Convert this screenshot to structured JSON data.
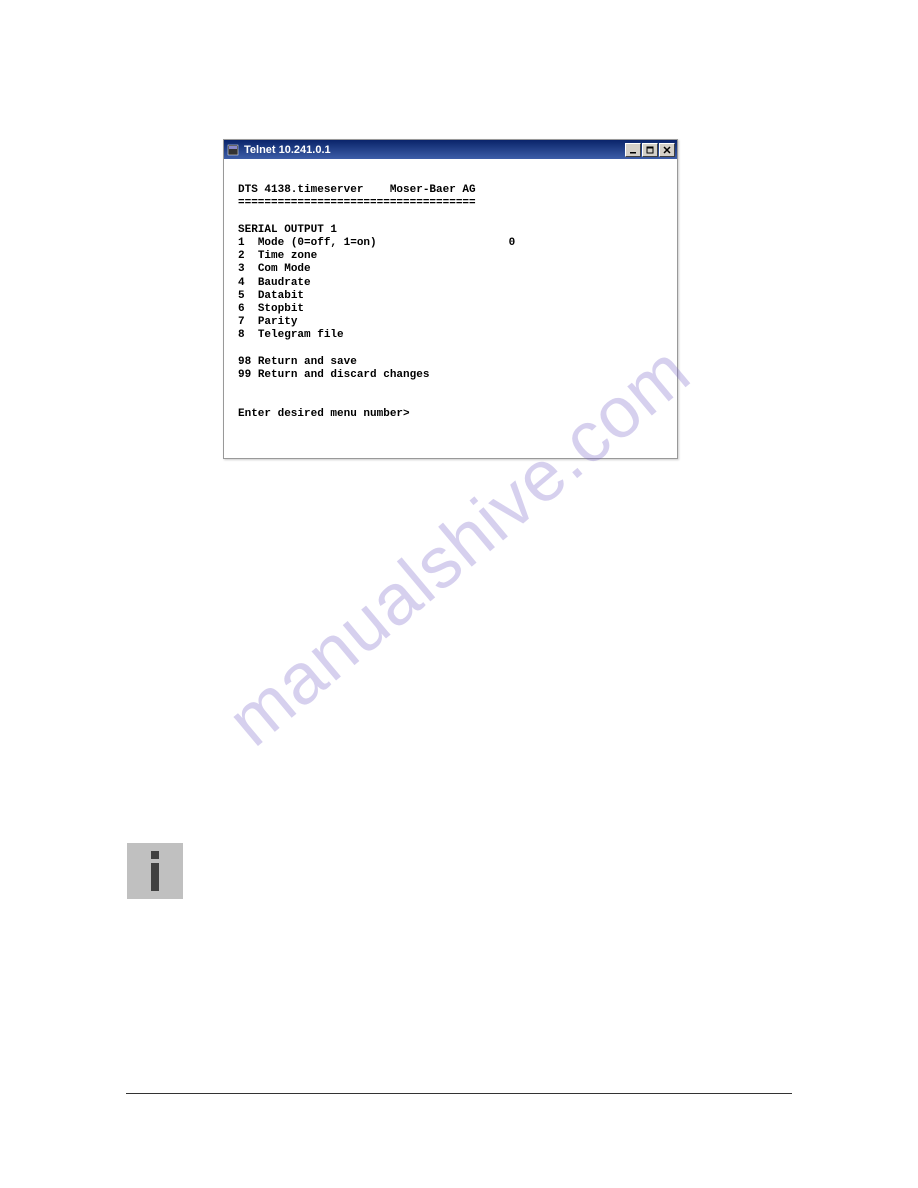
{
  "window": {
    "title": "Telnet 10.241.0.1"
  },
  "terminal": {
    "header_line1": "DTS 4138.timeserver    Moser-Baer AG",
    "header_line2": "====================================",
    "section_title": "SERIAL OUTPUT 1",
    "menu_items": [
      {
        "num": "1",
        "label": "Mode (0=off, 1=on)",
        "value": "0"
      },
      {
        "num": "2",
        "label": "Time zone",
        "value": ""
      },
      {
        "num": "3",
        "label": "Com Mode",
        "value": ""
      },
      {
        "num": "4",
        "label": "Baudrate",
        "value": ""
      },
      {
        "num": "5",
        "label": "Databit",
        "value": ""
      },
      {
        "num": "6",
        "label": "Stopbit",
        "value": ""
      },
      {
        "num": "7",
        "label": "Parity",
        "value": ""
      },
      {
        "num": "8",
        "label": "Telegram file",
        "value": ""
      }
    ],
    "footer_items": [
      {
        "num": "98",
        "label": "Return and save"
      },
      {
        "num": "99",
        "label": "Return and discard changes"
      }
    ],
    "prompt": "Enter desired menu number>"
  },
  "watermark_text": "manualshive.com"
}
